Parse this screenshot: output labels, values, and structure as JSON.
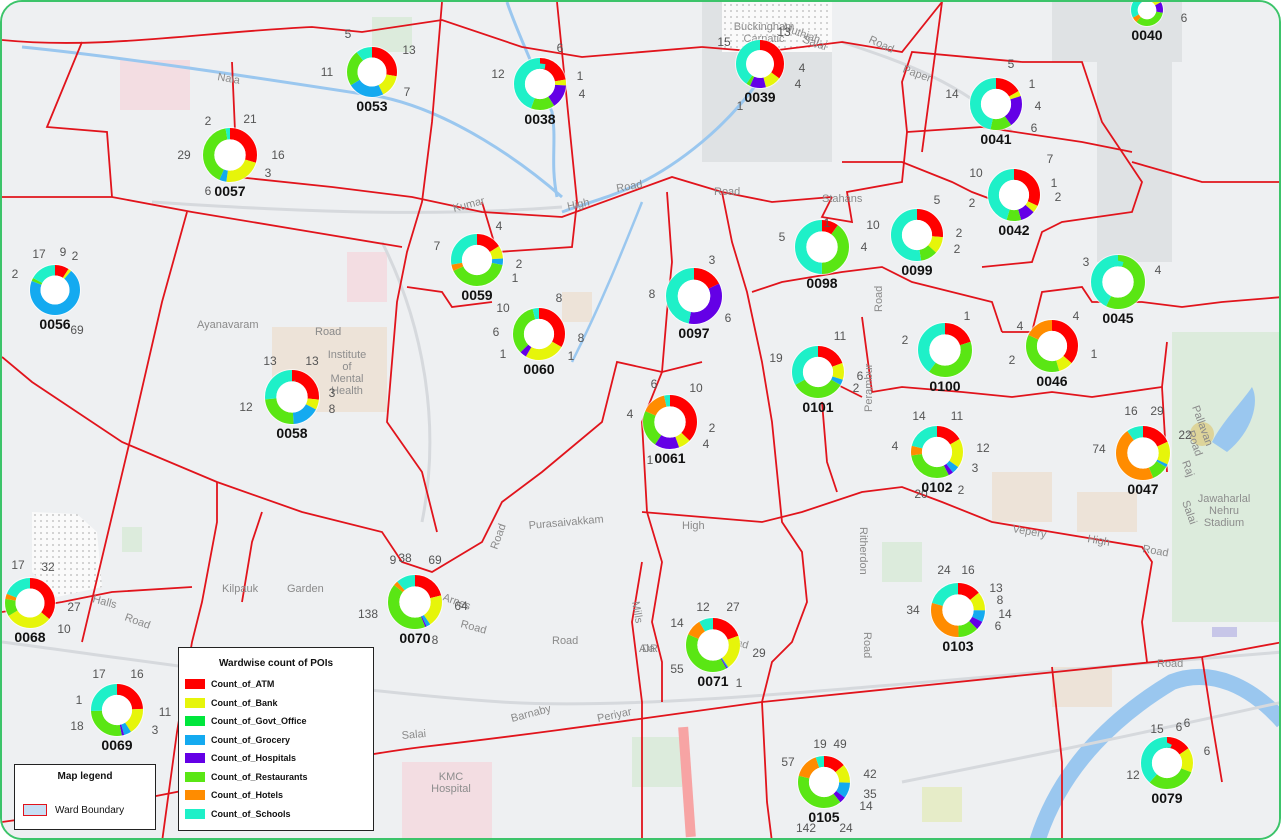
{
  "legend": {
    "title": "Wardwise count of POIs",
    "items": [
      {
        "label": "Count_of_ATM",
        "color": "#ff0000"
      },
      {
        "label": "Count_of_Bank",
        "color": "#e6f50a"
      },
      {
        "label": "Count_of_Govt_Office",
        "color": "#00e63c"
      },
      {
        "label": "Count_of_Grocery",
        "color": "#14aaf0"
      },
      {
        "label": "Count_of_Hospitals",
        "color": "#6400e6"
      },
      {
        "label": "Count_of_Restaurants",
        "color": "#5ae614"
      },
      {
        "label": "Count_of_Hotels",
        "color": "#ff8c00"
      },
      {
        "label": "Count_of_Schools",
        "color": "#1ef0c8"
      }
    ]
  },
  "map_legend": {
    "title": "Map legend",
    "item_label": "Ward Boundary",
    "boundary_color": "#e1141c"
  },
  "places": [
    {
      "name": "Institute of Mental Health"
    },
    {
      "name": "KMC Hospital"
    },
    {
      "name": "Jawaharlal Nehru Stadium"
    },
    {
      "name": "Buckingham Carnatic Mills"
    }
  ],
  "streets": [
    "Road",
    "Nala",
    "Kumar",
    "High",
    "Road",
    "Ayanavaram",
    "Road",
    "Purasaivakkam",
    "High",
    "Road",
    "Kilpauk",
    "Garden",
    "Halls",
    "Road",
    "Barnaby",
    "Road",
    "Periyar",
    "Salai",
    "Perambur",
    "Ritherdon",
    "Road",
    "Vepery",
    "High",
    "Road",
    "Road",
    "Salai",
    "Arnes",
    "Road",
    "DR",
    "Ala",
    "Road",
    "Mills",
    "Road",
    "Stahans",
    "Road",
    "Pallavan",
    "Road",
    "Raj",
    "Muthiah",
    "Salai",
    "Paper",
    "Mills",
    "Road"
  ],
  "wards": [
    {
      "id": "0053",
      "labels": [
        "5",
        "13",
        "11",
        "7"
      ]
    },
    {
      "id": "0038",
      "labels": [
        "6",
        "12",
        "1",
        "4"
      ]
    },
    {
      "id": "0039",
      "labels": [
        "13",
        "15",
        "4",
        "4",
        "1"
      ]
    },
    {
      "id": "0040",
      "labels": [
        "6"
      ]
    },
    {
      "id": "0057",
      "labels": [
        "2",
        "21",
        "29",
        "16",
        "6",
        "3"
      ]
    },
    {
      "id": "0041",
      "labels": [
        "5",
        "1",
        "14",
        "4",
        "6"
      ]
    },
    {
      "id": "0042",
      "labels": [
        "7",
        "10",
        "1",
        "2",
        "2"
      ]
    },
    {
      "id": "0056",
      "labels": [
        "17",
        "9",
        "2",
        "2",
        "69"
      ]
    },
    {
      "id": "0059",
      "labels": [
        "4",
        "7",
        "2",
        "1",
        "10"
      ]
    },
    {
      "id": "0097",
      "labels": [
        "3",
        "8",
        "6"
      ]
    },
    {
      "id": "0098",
      "labels": [
        "1",
        "5",
        "4"
      ]
    },
    {
      "id": "0099",
      "labels": [
        "5",
        "10",
        "2",
        "2"
      ]
    },
    {
      "id": "0045",
      "labels": [
        "3",
        "4"
      ]
    },
    {
      "id": "0060",
      "labels": [
        "8",
        "6",
        "8",
        "1",
        "1"
      ]
    },
    {
      "id": "0058",
      "labels": [
        "13",
        "13",
        "3",
        "12",
        "8"
      ]
    },
    {
      "id": "0100",
      "labels": [
        "1",
        "2"
      ]
    },
    {
      "id": "0046",
      "labels": [
        "4",
        "4",
        "2",
        "1"
      ]
    },
    {
      "id": "0101",
      "labels": [
        "11",
        "19",
        "6",
        "2"
      ]
    },
    {
      "id": "0061",
      "labels": [
        "6",
        "10",
        "4",
        "2",
        "4",
        "1"
      ]
    },
    {
      "id": "0102",
      "labels": [
        "14",
        "11",
        "4",
        "12",
        "3",
        "20",
        "2"
      ]
    },
    {
      "id": "0047",
      "labels": [
        "16",
        "29",
        "74",
        "22"
      ]
    },
    {
      "id": "0068",
      "labels": [
        "17",
        "32",
        "27",
        "10"
      ]
    },
    {
      "id": "0070",
      "labels": [
        "9",
        "38",
        "69",
        "138",
        "64",
        "8"
      ]
    },
    {
      "id": "0103",
      "labels": [
        "24",
        "16",
        "13",
        "34",
        "8",
        "14",
        "6"
      ]
    },
    {
      "id": "0071",
      "labels": [
        "14",
        "12",
        "27",
        "55",
        "29",
        "1"
      ]
    },
    {
      "id": "0069",
      "labels": [
        "17",
        "16",
        "1",
        "11",
        "18",
        "3"
      ]
    },
    {
      "id": "0105",
      "labels": [
        "19",
        "49",
        "57",
        "42",
        "35",
        "14",
        "142",
        "24"
      ]
    },
    {
      "id": "0079",
      "labels": [
        "15",
        "6",
        "6",
        "6",
        "12"
      ]
    }
  ],
  "chart_data": {
    "type": "pie",
    "categories": [
      "Count_of_ATM",
      "Count_of_Bank",
      "Count_of_Govt_Office",
      "Count_of_Grocery",
      "Count_of_Hospitals",
      "Count_of_Restaurants",
      "Count_of_Hotels",
      "Count_of_Schools"
    ],
    "series": [
      {
        "name": "0053",
        "values": [
          13,
          7,
          0,
          11,
          0,
          11,
          0,
          5
        ]
      },
      {
        "name": "0038",
        "values": [
          6,
          1,
          0,
          0,
          4,
          4,
          0,
          12
        ]
      },
      {
        "name": "0039",
        "values": [
          13,
          4,
          0,
          0,
          4,
          1,
          0,
          15
        ]
      },
      {
        "name": "0040",
        "values": [
          1,
          2,
          0,
          0,
          2,
          6,
          1,
          6
        ]
      },
      {
        "name": "0057",
        "values": [
          21,
          16,
          0,
          3,
          0,
          29,
          0,
          2
        ]
      },
      {
        "name": "0041",
        "values": [
          5,
          1,
          0,
          0,
          6,
          4,
          0,
          14
        ]
      },
      {
        "name": "0042",
        "values": [
          7,
          1,
          0,
          0,
          2,
          2,
          0,
          10
        ]
      },
      {
        "name": "0056",
        "values": [
          9,
          2,
          0,
          69,
          0,
          2,
          0,
          17
        ]
      },
      {
        "name": "0059",
        "values": [
          4,
          2,
          0,
          1,
          0,
          10,
          1,
          7
        ]
      },
      {
        "name": "0097",
        "values": [
          3,
          0,
          0,
          0,
          6,
          0,
          0,
          8
        ]
      },
      {
        "name": "0098",
        "values": [
          1,
          0,
          0,
          0,
          0,
          4,
          0,
          5
        ]
      },
      {
        "name": "0099",
        "values": [
          5,
          2,
          0,
          0,
          0,
          2,
          0,
          10
        ]
      },
      {
        "name": "0045",
        "values": [
          0,
          0,
          0,
          0,
          0,
          4,
          0,
          3
        ]
      },
      {
        "name": "0060",
        "values": [
          8,
          6,
          0,
          0,
          1,
          8,
          0,
          1
        ]
      },
      {
        "name": "0058",
        "values": [
          13,
          3,
          0,
          8,
          0,
          12,
          0,
          13
        ]
      },
      {
        "name": "0100",
        "values": [
          1,
          0,
          0,
          0,
          0,
          2,
          0,
          2
        ]
      },
      {
        "name": "0046",
        "values": [
          4,
          1,
          0,
          0,
          0,
          4,
          2,
          0
        ]
      },
      {
        "name": "0101",
        "values": [
          11,
          6,
          0,
          2,
          0,
          19,
          0,
          19
        ]
      },
      {
        "name": "0061",
        "values": [
          10,
          2,
          0,
          0,
          4,
          6,
          4,
          1
        ]
      },
      {
        "name": "0102",
        "values": [
          11,
          12,
          0,
          3,
          2,
          20,
          4,
          14
        ]
      },
      {
        "name": "0047",
        "values": [
          29,
          22,
          0,
          3,
          0,
          16,
          74,
          16
        ]
      },
      {
        "name": "0068",
        "values": [
          32,
          27,
          0,
          0,
          0,
          10,
          3,
          17
        ]
      },
      {
        "name": "0070",
        "values": [
          69,
          64,
          0,
          8,
          3,
          138,
          9,
          38
        ]
      },
      {
        "name": "0103",
        "values": [
          16,
          13,
          0,
          8,
          6,
          14,
          34,
          24
        ]
      },
      {
        "name": "0071",
        "values": [
          27,
          29,
          0,
          1,
          1,
          55,
          14,
          12
        ]
      },
      {
        "name": "0069",
        "values": [
          16,
          11,
          0,
          3,
          1,
          18,
          0,
          17
        ]
      },
      {
        "name": "0105",
        "values": [
          49,
          42,
          0,
          35,
          14,
          142,
          57,
          19
        ]
      },
      {
        "name": "0079",
        "values": [
          6,
          6,
          0,
          0,
          0,
          12,
          0,
          15
        ]
      }
    ]
  }
}
